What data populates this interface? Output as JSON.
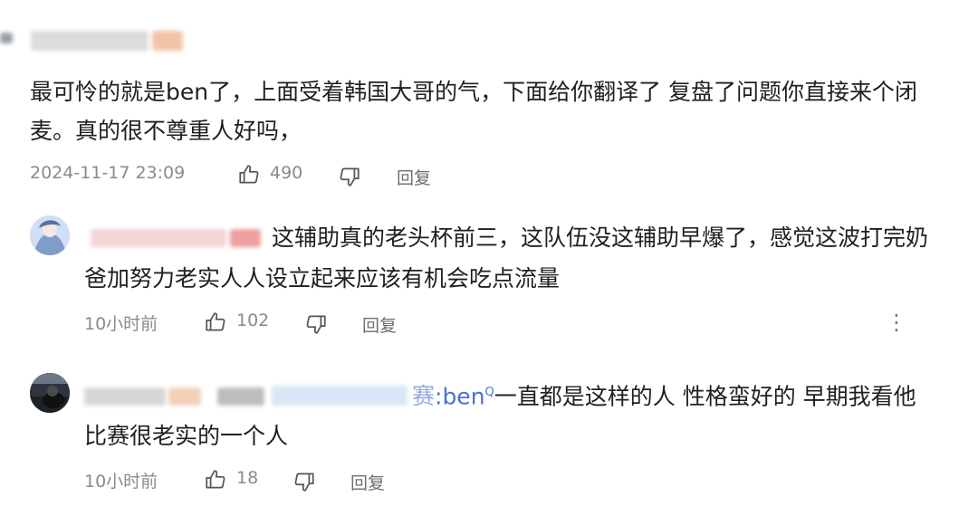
{
  "comments": [
    {
      "text_line1": "最可怜的就是ben了，上面受着韩国大哥的气，下面给你翻译了 复盘了问题你直接来个闭",
      "text_line2": "麦。真的很不尊重人好吗，",
      "timestamp": "2024-11-17 23:09",
      "like_count": "490",
      "reply_label": "回复"
    },
    {
      "text_line1": "这辅助真的老头杯前三，这队伍没这辅助早爆了，感觉这波打完奶",
      "text_line2": "爸加努力老实人人设立起来应该有机会吃点流量",
      "timestamp": "10小时前",
      "like_count": "102",
      "reply_label": "回复",
      "more_label": "⋮"
    },
    {
      "mention_prefix": "赛",
      "mention": ":ben",
      "mention_mark": "Q",
      "text_line1": "一直都是这样的人 性格蛮好的 早期我看他",
      "text_line2": "比赛很老实的一个人",
      "timestamp": "10小时前",
      "like_count": "18",
      "reply_label": "回复"
    }
  ],
  "colors": {
    "text": "#1f1f1f",
    "meta": "#8a8a8a",
    "mention": "#4a74c9"
  }
}
